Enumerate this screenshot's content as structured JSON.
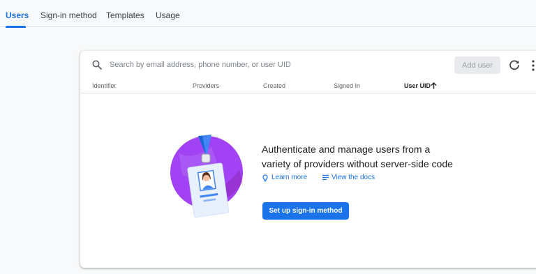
{
  "tabs": {
    "users": "Users",
    "sign_in_method": "Sign-in method",
    "templates": "Templates",
    "usage": "Usage"
  },
  "search": {
    "placeholder": "Search by email address, phone number, or user UID"
  },
  "toolbar": {
    "add_user_label": "Add user",
    "refresh_icon": "refresh-icon",
    "more_icon": "more-vert-icon"
  },
  "table": {
    "columns": [
      "Identifier",
      "Providers",
      "Created",
      "Signed In",
      "User UID"
    ],
    "sorted_column": "User UID",
    "sort_direction": "ascending"
  },
  "empty_state": {
    "headline_line1": "Authenticate and manage users from a",
    "headline_line2": "variety of providers without server-side code",
    "learn_more": "Learn more",
    "view_docs": "View the docs",
    "cta": "Set up sign-in method"
  },
  "colors": {
    "accent": "#1a73e8",
    "illustration_purple": "#a142f4"
  }
}
